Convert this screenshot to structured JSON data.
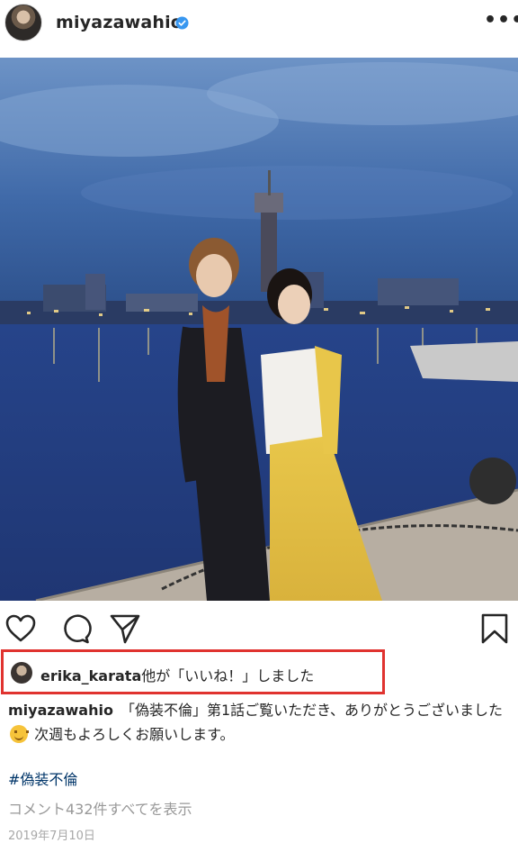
{
  "post": {
    "username": "miyazawahio",
    "verified_icon": "verified-badge-icon",
    "more_label": "•••"
  },
  "actions": {
    "like_icon": "heart-icon",
    "comment_icon": "comment-icon",
    "share_icon": "send-icon",
    "save_icon": "bookmark-icon"
  },
  "likes": {
    "user": "erika_karata",
    "text": "他が「いいね！」しました"
  },
  "caption": {
    "username": "miyazawahio",
    "text_part1": "「偽装不倫」第1話ご覧いただき、ありがとうございました",
    "text_part2": " 次週もよろしくお願いします。"
  },
  "hashtag": "#偽装不倫",
  "comments_link": "コメント432件すべてを表示",
  "date": "2019年7月10日",
  "colors": {
    "highlight_border": "#e0332f",
    "hashtag": "#003569",
    "muted": "#999999",
    "verified": "#3897f0"
  }
}
